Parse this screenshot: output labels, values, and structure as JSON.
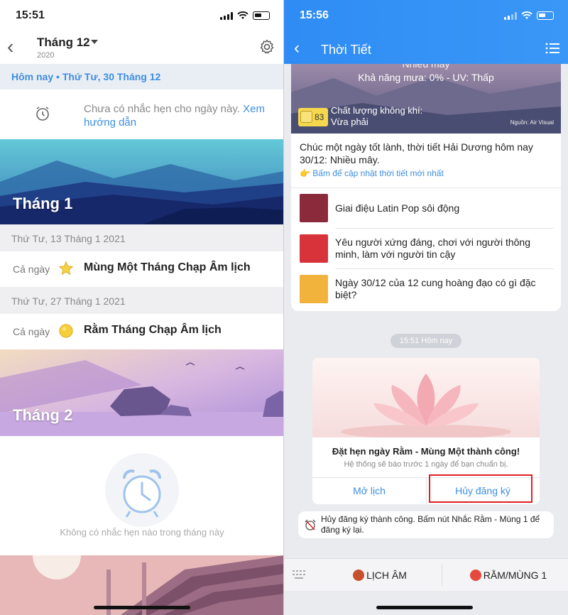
{
  "left": {
    "status_time": "15:51",
    "header": {
      "month": "Tháng 12",
      "year": "2020"
    },
    "today_bar": "Hôm nay • Thứ Tư, 30 Tháng 12",
    "reminder": {
      "text": "Chưa có nhắc hẹn cho ngày này.",
      "link": "Xem hướng dẫn"
    },
    "month1_label": "Tháng 1",
    "events": [
      {
        "date": "Thứ Tư, 13 Tháng 1 2021",
        "allday": "Cả ngày",
        "icon": "star-icon",
        "title": "Mùng Một Tháng Chạp Âm lịch"
      },
      {
        "date": "Thứ Tư, 27 Tháng 1 2021",
        "allday": "Cả ngày",
        "icon": "moon-icon",
        "title": "Rằm Tháng Chạp Âm lịch"
      }
    ],
    "month2_label": "Tháng 2",
    "empty_text": "Không có nhắc hẹn nào trong tháng này"
  },
  "right": {
    "status_time": "15:56",
    "header_title": "Thời Tiết",
    "weather": {
      "line1": "Nhiều mây",
      "line2": "Khả năng mưa: 0% - UV: Thấp",
      "aqi_value": "83",
      "aqi_label": "Chất lượng không khí:",
      "aqi_status": "Vừa phải",
      "source": "Nguồn: Air Visual",
      "greeting": "Chúc một ngày tốt lành, thời tiết Hải Dương hôm nay 30/12: Nhiều mây.",
      "update_link": "👉 Bấm để cập nhật thời tiết mới nhất"
    },
    "news": [
      {
        "title": "Giai điệu Latin Pop sôi động",
        "thumb_color": "#8a2a3a"
      },
      {
        "title": "Yêu người xứng đáng, chơi với người thông minh, làm với người tin cậy",
        "thumb_color": "#d8333a"
      },
      {
        "title": "Ngày 30/12 của 12 cung hoàng đạo có gì đặc biệt?",
        "thumb_color": "#f2b33d"
      }
    ],
    "time_chip": "15:51 Hôm nay",
    "confirm": {
      "title": "Đặt hẹn ngày Rằm - Mùng Một thành công!",
      "subtitle": "Hệ thống sẽ báo trước 1 ngày để bạn chuẩn bị.",
      "open_btn": "Mở lịch",
      "cancel_btn": "Hủy đăng ký"
    },
    "toast": "Hủy đăng ký thành công. Bấm nút Nhắc Rằm - Mùng 1 để đăng ký lại.",
    "bottom": {
      "lunar_btn": "LỊCH ÂM",
      "reminder_btn": "RẰM/MÙNG 1"
    }
  },
  "colors": {
    "accent": "#3d8ee0",
    "header_blue": "#2f8cf4",
    "highlight_red": "#e02020"
  }
}
